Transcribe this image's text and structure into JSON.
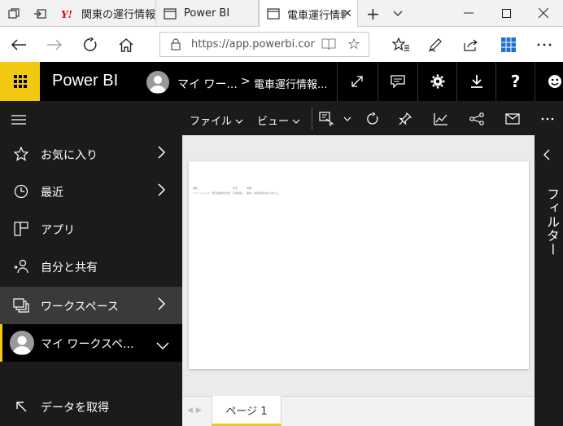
{
  "browser": {
    "tabs": [
      {
        "title": "関東の運行情報",
        "icon": "yahoo-y-icon",
        "active": false
      },
      {
        "title": "Power BI",
        "icon": "tab-page-icon",
        "active": false
      },
      {
        "title": "電車運行情報",
        "icon": "tab-page-icon",
        "active": true
      }
    ],
    "new_tab": "+",
    "url": "https://app.powerbi.com/",
    "window_controls": [
      "minimize",
      "maximize",
      "close"
    ]
  },
  "header": {
    "brand": "Power BI",
    "workspace": "マイ ワー...",
    "breadcrumb_sep": ">",
    "report": "電車運行情報...",
    "buttons": [
      "fullscreen-icon",
      "comment-icon",
      "settings-icon",
      "download-icon",
      "help-icon",
      "smiley-icon"
    ],
    "help_label": "?"
  },
  "sidebar": {
    "items": [
      {
        "label": "お気に入り",
        "icon": "star-icon",
        "chevron": true
      },
      {
        "label": "最近",
        "icon": "clock-icon",
        "chevron": true
      },
      {
        "label": "アプリ",
        "icon": "apps-icon",
        "chevron": false
      },
      {
        "label": "自分と共有",
        "icon": "shared-icon",
        "chevron": false
      },
      {
        "label": "ワークスペース",
        "icon": "workspaces-icon",
        "chevron": true
      },
      {
        "label": "マイ ワークスペ...",
        "icon": "avatar",
        "chevron": true
      }
    ],
    "get_data": "データを取得"
  },
  "toolbar": {
    "file": "ファイル",
    "view": "ビュー",
    "icons": [
      "view-mode-icon",
      "refresh-icon",
      "pin-icon",
      "insights-icon",
      "share-icon",
      "subscribe-icon",
      "more-icon"
    ]
  },
  "report_table": {
    "headers": [
      "路線",
      "状況",
      "詳細"
    ],
    "rows": [
      [
        "ニューシャトル（埼玉新都市交通）",
        "平常運転",
        "事故・遅延情報はありません。"
      ]
    ]
  },
  "filters": {
    "title": "フィルター"
  },
  "pages": [
    {
      "label": "ページ 1",
      "active": true
    }
  ],
  "colors": {
    "accent": "#f2c811",
    "header_bg": "#000000",
    "sidebar_bg": "#1b1b1b",
    "canvas_bg": "#ebebeb"
  }
}
